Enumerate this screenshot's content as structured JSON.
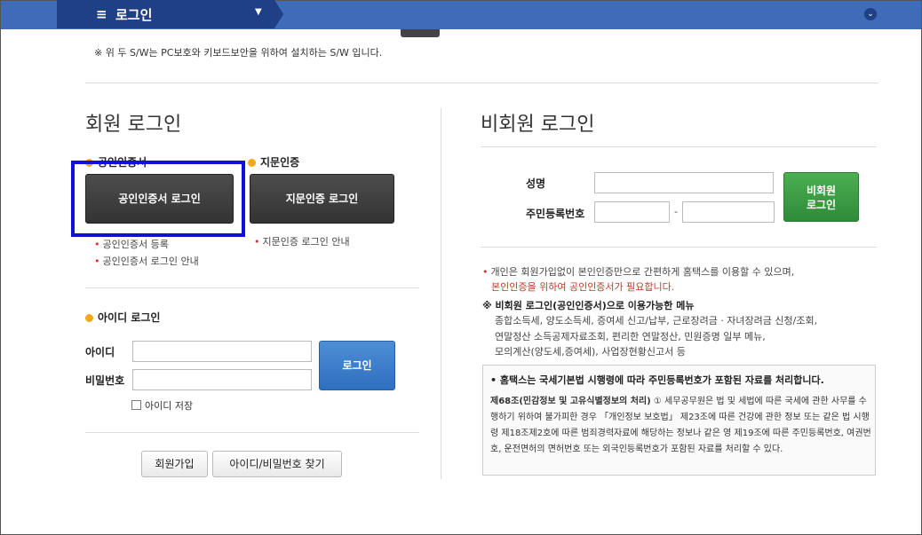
{
  "header": {
    "menu_icon": "≡",
    "title": "로그인",
    "dropdown_caret": "▼",
    "circle_icon": "chevron-down-icon",
    "circle_glyph": "⌄",
    "colors": {
      "bar": "#3f6bb8",
      "tab": "#1f3f86"
    }
  },
  "note": "※ 위 두 S/W는 PC보호와 키보드보안을 위하여 설치하는 S/W 입니다.",
  "member": {
    "title": "회원 로그인",
    "cert_section": "공인인증서",
    "finger_section": "지문인증",
    "cert_login_button": "공인인증서 로그인",
    "finger_login_button": "지문인증 로그인",
    "cert_register_link": "공인인증서 등록",
    "cert_guide_link": "공인인증서 로그인 안내",
    "finger_guide_link": "지문인증 로그인 안내",
    "id_section": "아이디 로그인",
    "id_label": "아이디",
    "pw_label": "비밀번호",
    "login_button": "로그인",
    "save_id_label": "아이디 저장",
    "join_button": "회원가입",
    "find_button": "아이디/비밀번호 찾기"
  },
  "guest": {
    "title": "비회원 로그인",
    "name_label": "성명",
    "rrn_label": "주민등록번호",
    "rrn_dash": "-",
    "login_button_line1": "비회원",
    "login_button_line2": "로그인",
    "info1": "개인은 회원가입없이 본인인증만으로 간편하게 홈택스를 이용할 수 있으며,",
    "info2": "본인인증을 위하여 공인인증서가 필요합니다.",
    "menu_title": "※ 비회원 로그인(공인인증서)으로 이용가능한 메뉴",
    "menu_lines": [
      "종합소득세, 양도소득세, 증여세 신고/납부, 근로장려금 · 자녀장려금 신청/조회,",
      "연말정산 소득공제자료조회, 편리한 연말정산, 민원증명 일부 메뉴,",
      "모의계산(양도세,증여세), 사업장현황신고서 등"
    ],
    "box_head": "• 홈택스는 국세기본법 시행령에 따라 주민등록번호가 포함된 자료를 처리합니다.",
    "box_law_title": "제68조(민감정보 및 고유식별정보의 처리)",
    "box_law_text": " ① 세무공무원은 법 및 세법에 따른 국세에 관한 사무를 수행하기 위하여 불가피한 경우 「개인정보 보호법」 제23조에 따른 건강에 관한 정보 또는 같은 법 시행령 제18조제2호에 따른 범죄경력자료에 해당하는 정보나 같은 영 제19조에 따른 주민등록번호, 여권번호, 운전면허의 면허번호 또는 외국인등록번호가 포함된 자료를 처리할 수 있다."
  }
}
